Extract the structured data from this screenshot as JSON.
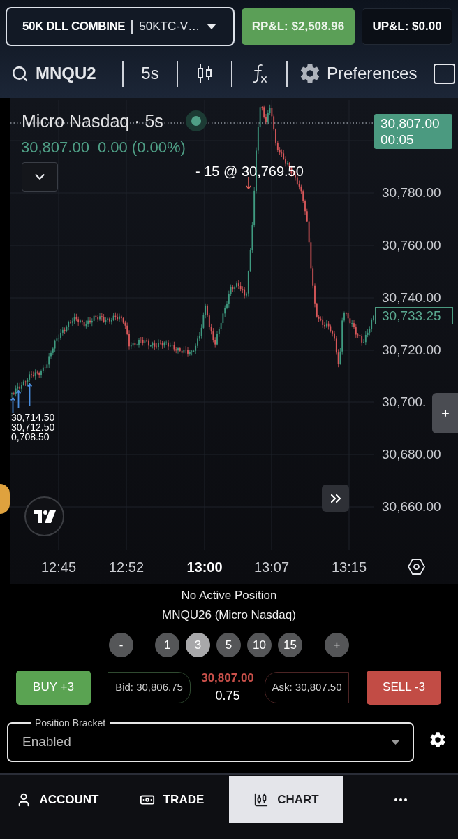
{
  "account_selector": {
    "name": "50K DLL COMBINE",
    "account": "50KTC-V…"
  },
  "pnl": [
    {
      "kind": "realized",
      "label": "RP&L: $2,508.96"
    },
    {
      "kind": "unrealized",
      "label": "UP&L: $0.00"
    }
  ],
  "toolbar": {
    "symbol": "MNQU2",
    "interval": "5s",
    "preferences": "Preferences",
    "checkbox": {
      "checked": false
    }
  },
  "chart": {
    "legend": {
      "title": "Micro Nasdaq · 5s",
      "price": "30,807.00",
      "change": "0.00 (0.00%)"
    },
    "last_price": {
      "price": "30,807.00",
      "countdown": "00:05"
    },
    "trade_marker": "- 15 @ 30,769.50",
    "fill_labels": [
      "30,714.50",
      "30,712.50",
      "0,708.50"
    ],
    "price_axis": [
      "30,780.00",
      "30,760.00",
      "30,740.00",
      "30,720.00",
      "30,700.",
      "30,680.00",
      "30,660.00"
    ],
    "marked_price": "30,733.25",
    "time_axis": [
      {
        "label": "12:45",
        "major": false
      },
      {
        "label": "12:52",
        "major": false
      },
      {
        "label": "13:00",
        "major": true
      },
      {
        "label": "13:07",
        "major": false
      },
      {
        "label": "13:15",
        "major": false
      }
    ]
  },
  "position": {
    "status": "No Active Position",
    "contract": "MNQU26 (Micro Nasdaq)"
  },
  "quantity": {
    "decrease": "-",
    "presets": [
      {
        "label": "1",
        "selected": false
      },
      {
        "label": "3",
        "selected": true
      },
      {
        "label": "5",
        "selected": false
      },
      {
        "label": "10",
        "selected": false
      },
      {
        "label": "15",
        "selected": false
      }
    ],
    "increase": "+"
  },
  "order": {
    "buy": "BUY +3",
    "bid": "Bid: 30,806.75",
    "last": "30,807.00",
    "spread": "0.75",
    "ask": "Ask: 30,807.50",
    "sell": "SELL -3"
  },
  "position_bracket": {
    "label": "Position Bracket",
    "value": "Enabled"
  },
  "nav": [
    {
      "kind": "account",
      "label": "ACCOUNT",
      "selected": false
    },
    {
      "kind": "trade",
      "label": "TRADE",
      "selected": false
    },
    {
      "kind": "chart",
      "label": "CHART",
      "selected": true
    },
    {
      "kind": "more",
      "selected": false
    }
  ]
}
